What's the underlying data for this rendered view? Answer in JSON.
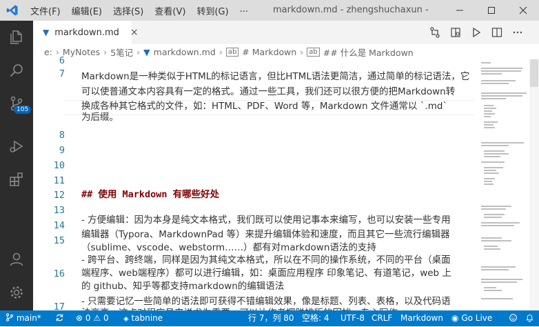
{
  "titlebar": {
    "menu": [
      "文件(F)",
      "编辑(E)",
      "选择(S)",
      "查看(V)",
      "转到(G)"
    ],
    "more": "...",
    "title": "markdown.md - zhengshuchaxun - Visual St"
  },
  "activity": {
    "scm_badge": "105"
  },
  "tabs": [
    {
      "label": "markdown.md",
      "close": "×"
    }
  ],
  "breadcrumb": {
    "items": [
      "e:",
      "MyNotes",
      "5笔记",
      "markdown.md",
      "# Markdown",
      "## 什么是 Markdown"
    ],
    "sep": "›"
  },
  "editor": {
    "line_numbers": [
      "6",
      "7",
      "8",
      "9",
      "10",
      "11",
      "12",
      "13",
      "14",
      "15",
      "16",
      "17"
    ],
    "lines": {
      "l7a": "Markdown是一种类似于HTML的标记语言，但比HTML语法更简洁，通过简单的标记语法，它",
      "l7b": "可以使普通文本内容具有一定的格式。通过一些工具，我们还可以很方便的把Markdown转",
      "l7c": "换成各种其它格式的文件，如：HTML、PDF、Word 等，Markdown 文件通常以 `.md`",
      "l7d": "为后缀。",
      "l13": "## 使用 Markdown 有哪些好处",
      "l15a": "- 方便编辑：因为本身是纯文本格式，我们既可以使用记事本来编写，也可以安装一些专用",
      "l15b": "编辑器（Typora、MarkdownPad 等）来提升编辑体验和速度，而且其它一些流行编辑器",
      "l15c": "（sublime、vscode、webstorm……）都有对markdown语法的支持",
      "l16a": "- 跨平台、跨终端，同样是因为其纯文本格式，所以在不同的操作系统，不同的平台（桌面",
      "l16b": "端程序、web端程序）都可以进行编辑，如：桌面应用程序 印象笔记、有道笔记，web 上",
      "l16c": "的 github、知乎等都支持markdown的编辑语法",
      "l17a": "- 只需要记忆一些简单的语法即可获得不错编辑效果，像是标题、列表、表格，以及代码语",
      "l17b": "法高亮 - 这点对程序员来说尤为重要，可以让作者摆脱排版的困扰，专心写作"
    }
  },
  "statusbar": {
    "branch": "main*",
    "errors": "0",
    "warnings": "0",
    "tabnine": "tabnine",
    "position": "行 7，列 80",
    "spaces": "空格: 4",
    "encoding": "UTF-8",
    "eol": "CRLF",
    "language": "Markdown",
    "golive": "Go Live"
  },
  "colors": {
    "statusbar": "#007acc",
    "activitybar": "#2c2c2c",
    "heading": "#800000",
    "line_number": "#237893"
  }
}
